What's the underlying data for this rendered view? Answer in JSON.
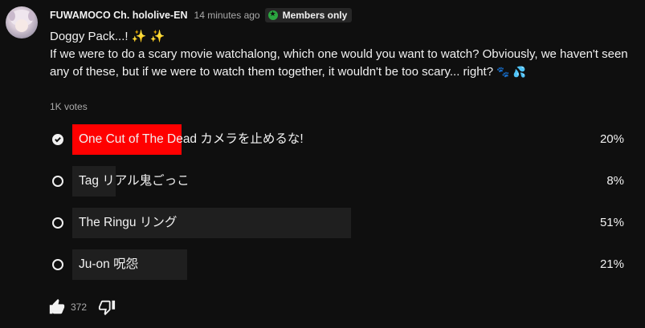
{
  "post": {
    "author": "FUWAMOCO Ch. hololive-EN",
    "time": "14 minutes ago",
    "members_badge": "Members only",
    "title_line": "Doggy Pack...!",
    "sparkles": "✨ ✨",
    "body_text": "If we were to do a scary movie watchalong, which one would you want to watch? Obviously, we haven't seen any of these, but if we were to watch them together, it wouldn't be too scary... right?",
    "trailing_emoji_paw": "🐾",
    "trailing_emoji_drops": "💦",
    "votes": "1K votes"
  },
  "poll": {
    "options": [
      {
        "label": "One Cut of The Dead カメラを止めるな!",
        "percent": "20%",
        "share": 0.2,
        "selected": true
      },
      {
        "label": "Tag リアル鬼ごっこ",
        "percent": "8%",
        "share": 0.08,
        "selected": false
      },
      {
        "label": "The Ringu リング",
        "percent": "51%",
        "share": 0.51,
        "selected": false
      },
      {
        "label": "Ju-on 呪怨",
        "percent": "21%",
        "share": 0.21,
        "selected": false
      }
    ]
  },
  "actions": {
    "like_count": "372",
    "like_icon": "thumbs-up-icon",
    "dislike_icon": "thumbs-down-icon"
  },
  "colors": {
    "background": "#0f0f0f",
    "selected_bar": "#ff0000",
    "option_bar": "#1f1f1f",
    "members_badge_icon": "#2ba640"
  }
}
